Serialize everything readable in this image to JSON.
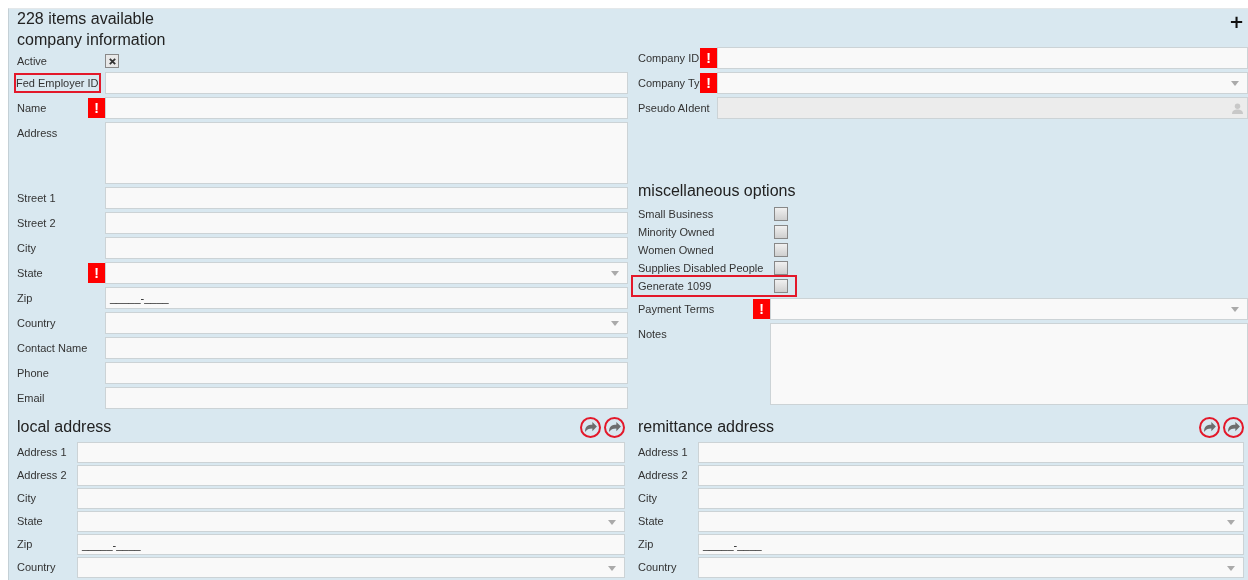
{
  "header": {
    "title": "228 items available",
    "add_button": "+"
  },
  "company_information": {
    "heading": "company information",
    "fields": [
      {
        "label": "Active",
        "kind": "checkbox",
        "checked": true,
        "highlighted": false
      },
      {
        "label": "Fed Employer ID",
        "kind": "text",
        "highlighted": true
      },
      {
        "label": "Name",
        "kind": "text",
        "required_mark": "!",
        "highlighted": false
      },
      {
        "label": "Address",
        "kind": "textarea",
        "highlighted": false
      },
      {
        "label": "Street 1",
        "kind": "text",
        "highlighted": false
      },
      {
        "label": "Street 2",
        "kind": "text",
        "highlighted": false
      },
      {
        "label": "City",
        "kind": "text",
        "highlighted": false
      },
      {
        "label": "State",
        "kind": "select",
        "required_mark": "!",
        "highlighted": false
      },
      {
        "label": "Zip",
        "kind": "zip",
        "value": "_____-____",
        "highlighted": false
      },
      {
        "label": "Country",
        "kind": "select",
        "highlighted": false
      },
      {
        "label": "Contact Name",
        "kind": "text",
        "highlighted": false
      },
      {
        "label": "Phone",
        "kind": "text",
        "highlighted": false
      },
      {
        "label": "Email",
        "kind": "text",
        "highlighted": false
      }
    ]
  },
  "company_ids": {
    "fields": [
      {
        "label": "Company ID",
        "kind": "text",
        "required_mark": "!",
        "highlighted": false
      },
      {
        "label": "Company Ty",
        "kind": "select",
        "required_mark": "!",
        "highlighted": false
      },
      {
        "label": "Pseudo AIdent",
        "kind": "lookup",
        "highlighted": false
      }
    ]
  },
  "miscellaneous_options": {
    "heading": "miscellaneous options",
    "options": [
      {
        "label": "Small Business",
        "checked": false,
        "highlighted": false
      },
      {
        "label": "Minority Owned",
        "checked": false,
        "highlighted": false
      },
      {
        "label": "Women Owned",
        "checked": false,
        "highlighted": false
      },
      {
        "label": "Supplies Disabled People",
        "checked": false,
        "highlighted": false
      },
      {
        "label": "Generate 1099",
        "checked": false,
        "highlighted": true
      }
    ],
    "fields": [
      {
        "label": "Payment Terms",
        "kind": "select",
        "required_mark": "!",
        "highlighted": false
      },
      {
        "label": "Notes",
        "kind": "textarea",
        "highlighted": false
      }
    ]
  },
  "address_sections": [
    {
      "heading": "local address",
      "actions": [
        {
          "highlighted": true
        },
        {
          "highlighted": true
        }
      ],
      "fields": [
        {
          "label": "Address 1",
          "kind": "text",
          "highlighted": false
        },
        {
          "label": "Address 2",
          "kind": "text",
          "highlighted": false
        },
        {
          "label": "City",
          "kind": "text",
          "highlighted": false
        },
        {
          "label": "State",
          "kind": "select",
          "highlighted": false
        },
        {
          "label": "Zip",
          "kind": "zip",
          "value": "_____-____",
          "highlighted": false
        },
        {
          "label": "Country",
          "kind": "select",
          "highlighted": false
        }
      ]
    },
    {
      "heading": "remittance address",
      "actions": [
        {
          "highlighted": true
        },
        {
          "highlighted": true
        }
      ],
      "fields": [
        {
          "label": "Address 1",
          "kind": "text",
          "highlighted": false
        },
        {
          "label": "Address 2",
          "kind": "text",
          "highlighted": false
        },
        {
          "label": "City",
          "kind": "text",
          "highlighted": false
        },
        {
          "label": "State",
          "kind": "select",
          "highlighted": false
        },
        {
          "label": "Zip",
          "kind": "zip",
          "value": "_____-____",
          "highlighted": false
        },
        {
          "label": "Country",
          "kind": "select",
          "highlighted": false
        }
      ]
    }
  ]
}
